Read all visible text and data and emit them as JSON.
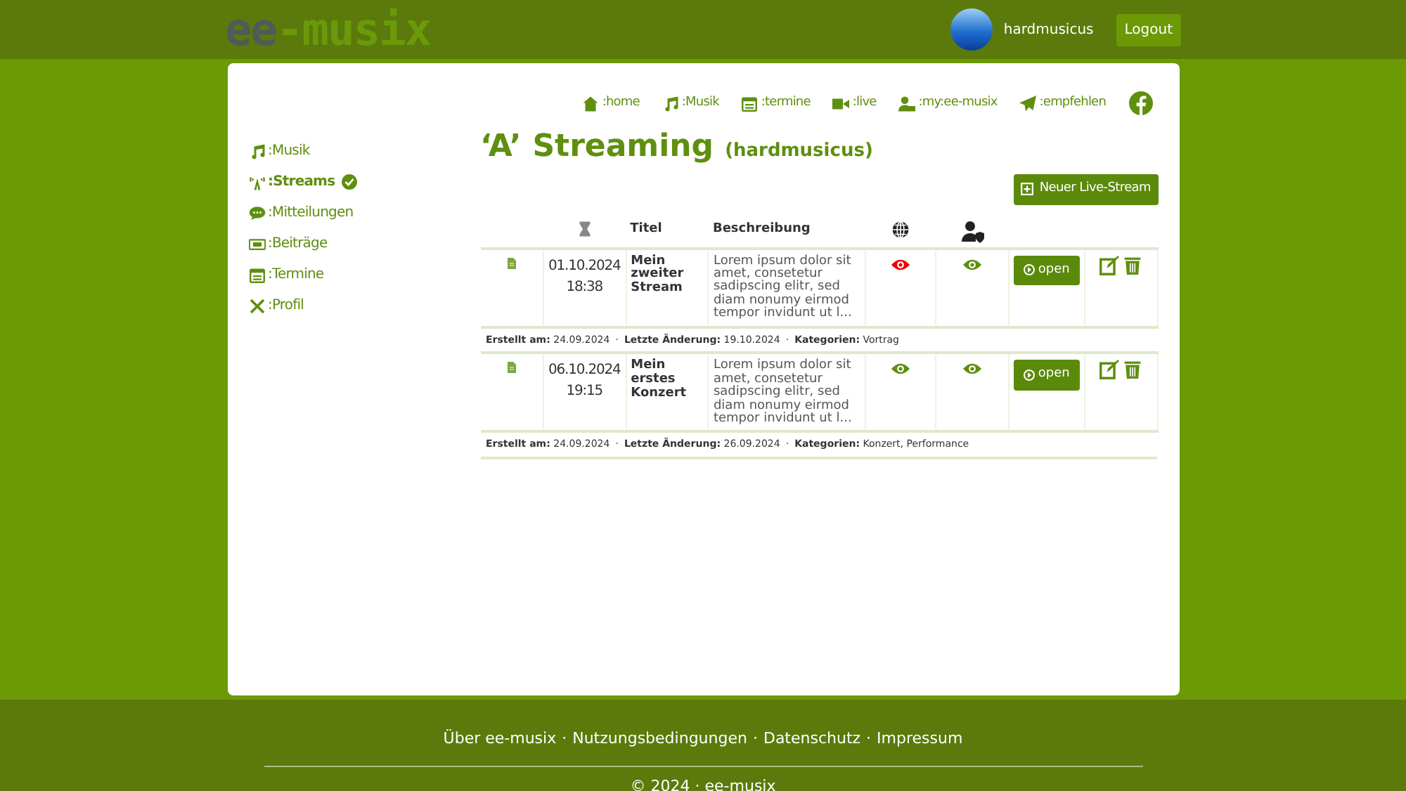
{
  "header": {
    "logo": {
      "first": "ee",
      "second": "-musix"
    },
    "user": "hardmusicus",
    "logout": "Logout"
  },
  "nav": [
    {
      "kind": "home",
      "label": ":home"
    },
    {
      "kind": "music",
      "label": ":Musik"
    },
    {
      "kind": "calendar",
      "label": ":termine"
    },
    {
      "kind": "video",
      "label": ":live"
    },
    {
      "kind": "user",
      "label": ":my:ee-musix"
    },
    {
      "kind": "send",
      "label": ":empfehlen"
    },
    {
      "kind": "facebook"
    }
  ],
  "sidebar": {
    "items": [
      {
        "kind": "music",
        "label": ":Musik",
        "selected": false
      },
      {
        "kind": "stream",
        "label": ":Streams",
        "selected": true
      },
      {
        "kind": "chat",
        "label": ":Mitteilungen",
        "selected": false
      },
      {
        "kind": "ticket",
        "label": ":Beiträge",
        "selected": false
      },
      {
        "kind": "calendar",
        "label": ":Termine",
        "selected": false
      },
      {
        "kind": "tools",
        "label": ":Profil",
        "selected": false
      }
    ]
  },
  "heading": {
    "icon_text": "‘A’",
    "title": "Streaming",
    "user": "(hardmusicus)"
  },
  "new_button": "Neuer Live-Stream",
  "table": {
    "columns": [
      "Titel",
      "Beschreibung"
    ],
    "rows": [
      {
        "date": "01.10.2024",
        "time": "18:38",
        "title": "Mein zweiter Stream",
        "description": "Lorem ipsum dolor sit amet, consetetur sadipscing elitr, sed diam nonumy eirmod tempor invidunt ut l...",
        "public": false,
        "members": true,
        "open": "open",
        "meta": [
          {
            "label": "Erstellt am:",
            "value": "24.09.2024"
          },
          {
            "label": "Letzte Änderung:",
            "value": "19.10.2024"
          },
          {
            "label": "Kategorien:",
            "value": "Vortrag"
          }
        ]
      },
      {
        "date": "06.10.2024",
        "time": "19:15",
        "title": "Mein erstes Konzert",
        "description": "Lorem ipsum dolor sit amet, consetetur sadipscing elitr, sed diam nonumy eirmod tempor invidunt ut l...",
        "public": true,
        "members": true,
        "open": "open",
        "meta": [
          {
            "label": "Erstellt am:",
            "value": "24.09.2024"
          },
          {
            "label": "Letzte Änderung:",
            "value": "26.09.2024"
          },
          {
            "label": "Kategorien:",
            "value": "Konzert, Performance"
          }
        ]
      }
    ]
  },
  "meta_separator": "·",
  "footer": {
    "links": [
      "Über ee-musix",
      "Nutzungsbedingungen",
      "Datenschutz",
      "Impressum"
    ],
    "separator": "·",
    "copyright": "© 2024 · ee-musix"
  }
}
